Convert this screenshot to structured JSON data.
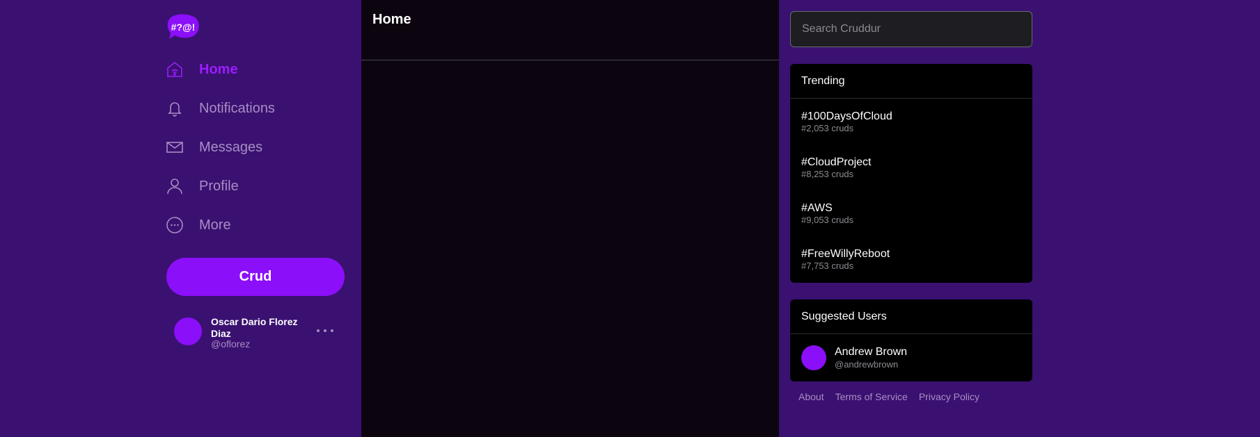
{
  "logo": {
    "text": "#?@!"
  },
  "nav": {
    "items": [
      {
        "label": "Home",
        "icon": "home-icon",
        "active": true
      },
      {
        "label": "Notifications",
        "icon": "bell-icon",
        "active": false
      },
      {
        "label": "Messages",
        "icon": "envelope-icon",
        "active": false
      },
      {
        "label": "Profile",
        "icon": "user-icon",
        "active": false
      },
      {
        "label": "More",
        "icon": "more-icon",
        "active": false
      }
    ]
  },
  "crud_button": {
    "label": "Crud"
  },
  "current_user": {
    "name": "Oscar Dario Florez Diaz",
    "handle": "@oflorez"
  },
  "main": {
    "title": "Home"
  },
  "search": {
    "placeholder": "Search Cruddur"
  },
  "trending": {
    "title": "Trending",
    "items": [
      {
        "tag": "#100DaysOfCloud",
        "count": "#2,053 cruds"
      },
      {
        "tag": "#CloudProject",
        "count": "#8,253 cruds"
      },
      {
        "tag": "#AWS",
        "count": "#9,053 cruds"
      },
      {
        "tag": "#FreeWillyReboot",
        "count": "#7,753 cruds"
      }
    ]
  },
  "suggested": {
    "title": "Suggested Users",
    "users": [
      {
        "name": "Andrew Brown",
        "handle": "@andrewbrown"
      }
    ]
  },
  "footer": {
    "about": "About",
    "terms": "Terms of Service",
    "privacy": "Privacy Policy"
  },
  "colors": {
    "sidebar_bg": "#3a1170",
    "main_bg": "#0c050f",
    "accent": "#8b0ff9",
    "nav_text": "#a98cc6"
  }
}
